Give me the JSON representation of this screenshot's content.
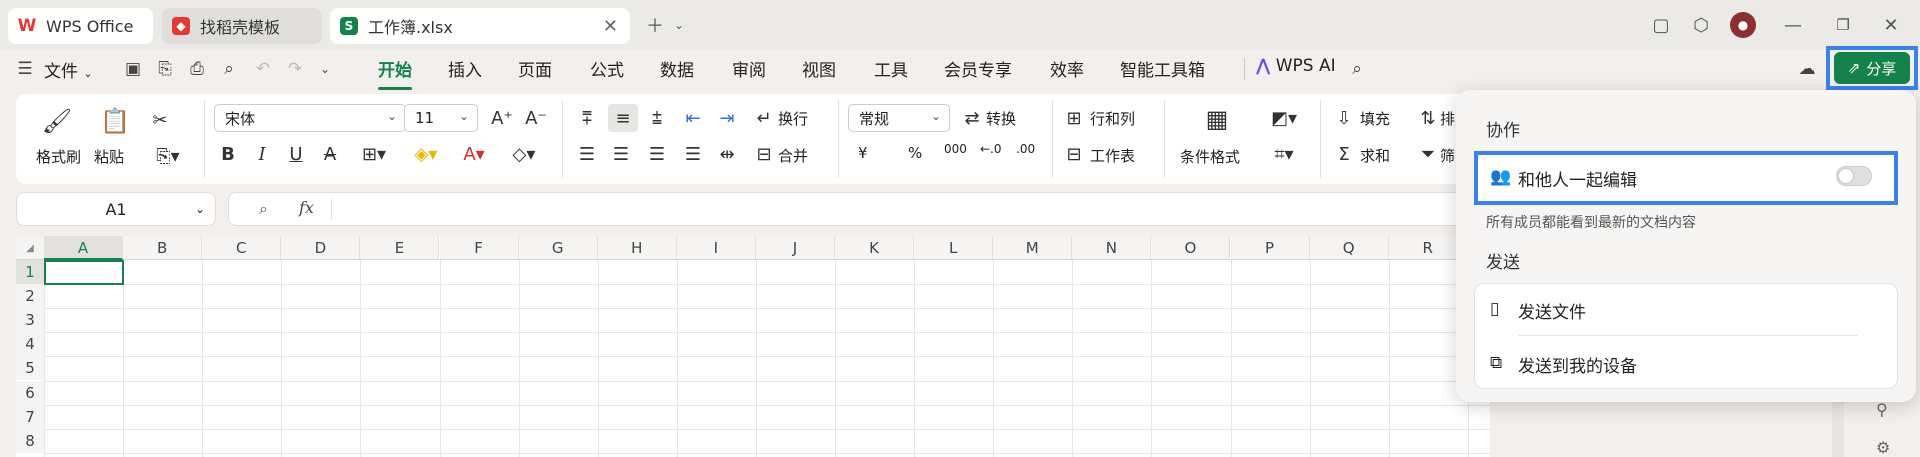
{
  "tabs": [
    {
      "label": "WPS Office"
    },
    {
      "label": "找稻壳模板"
    },
    {
      "label": "工作簿.xlsx"
    }
  ],
  "menu": {
    "file": "文件",
    "items": [
      "开始",
      "插入",
      "页面",
      "公式",
      "数据",
      "审阅",
      "视图",
      "工具",
      "会员专享",
      "效率",
      "智能工具箱"
    ],
    "ai": "WPS AI"
  },
  "ribbon": {
    "format_painter": "格式刷",
    "paste": "粘贴",
    "font_name": "宋体",
    "font_size": "11",
    "wrap": "换行",
    "merge": "合并",
    "number_format": "常规",
    "convert": "转换",
    "row_col": "行和列",
    "worksheet": "工作表",
    "cond_format": "条件格式",
    "fill": "填充",
    "sum": "求和",
    "sort_partial": "排",
    "filter_partial": "筛",
    "currency": "¥",
    "percent": "%",
    "thousands": "000",
    "dec_dec": "←.0",
    "dec_inc": ".00"
  },
  "formula": {
    "name_box": "A1",
    "fx": "fx"
  },
  "grid": {
    "columns": [
      "A",
      "B",
      "C",
      "D",
      "E",
      "F",
      "G",
      "H",
      "I",
      "J",
      "K",
      "L",
      "M",
      "N",
      "O",
      "P",
      "Q",
      "R"
    ],
    "rows": [
      "1",
      "2",
      "3",
      "4",
      "5",
      "6",
      "7",
      "8"
    ],
    "corner": "◢"
  },
  "share": {
    "button": "分享",
    "section_collab": "协作",
    "collab_option": "和他人一起编辑",
    "collab_desc": "所有成员都能看到最新的文档内容",
    "section_send": "发送",
    "send_file": "发送文件",
    "send_device": "发送到我的设备"
  },
  "colors": {
    "accent": "#15824c",
    "highlight": "#3b82e8",
    "wps_red": "#e53935"
  }
}
